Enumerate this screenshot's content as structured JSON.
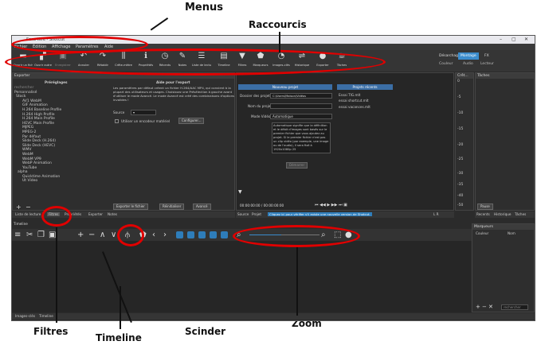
{
  "window": {
    "title": "Sans titre - Shotcut"
  },
  "menu": [
    "Fichier",
    "Édition",
    "Affichage",
    "Paramètres",
    "Aide"
  ],
  "toolbar": [
    {
      "label": "Ouvrir un fichier",
      "icon": "folder-icon"
    },
    {
      "label": "Ouvrir autre",
      "icon": "open-other-icon"
    },
    {
      "label": "Enregistrer",
      "icon": "save-icon"
    },
    {
      "label": "Annuler",
      "icon": "undo-icon"
    },
    {
      "label": "Rétablir",
      "icon": "redo-icon"
    },
    {
      "label": "Crête-mètre",
      "icon": "meter-icon"
    },
    {
      "label": "Propriétés",
      "icon": "info-icon"
    },
    {
      "label": "Récents",
      "icon": "clock-icon"
    },
    {
      "label": "Notes",
      "icon": "notes-icon"
    },
    {
      "label": "Liste de lecture",
      "icon": "playlist-icon"
    },
    {
      "label": "Timeline",
      "icon": "timeline-icon"
    },
    {
      "label": "Filtres",
      "icon": "filter-icon"
    },
    {
      "label": "Marqueurs",
      "icon": "marker-icon"
    },
    {
      "label": "Images-clés",
      "icon": "keyframes-icon"
    },
    {
      "label": "Historique",
      "icon": "history-icon"
    },
    {
      "label": "Exporter",
      "icon": "export-icon"
    },
    {
      "label": "Tâches",
      "icon": "jobs-icon"
    }
  ],
  "workspaces": {
    "tabs": [
      "Désarchage",
      "Montage",
      "FX"
    ],
    "active": "Montage",
    "sub": [
      "Couleur",
      "Audio",
      "Lecteur"
    ]
  },
  "export_panel": {
    "title": "Exporter",
    "presets_header": "Préréglages",
    "search_placeholder": "rechercher",
    "presets": [
      "Personnalisé",
      "Stock",
      "AV1 WebM",
      "GIF Animation",
      "H.264 Baseline Profile",
      "H.264 High Profile",
      "H.264 Main Profile",
      "HEVC Main Profile",
      "MJPEG",
      "MPEG-2",
      "Par défaut",
      "Slide Deck (H.264)",
      "Slide Deck (HEVC)",
      "WMV",
      "WebM",
      "WebM VP9",
      "WebP Animation",
      "YouTube",
      "alpha",
      "Quicktime Animation",
      "Ut Video",
      "Ut Video (4:4:4) alpha"
    ],
    "help_title": "Aide pour l'export",
    "help_text": "Les paramètres par défaut créent un fichier H.264/AAC MP4, qui convient à la plupart des utilisateurs et usages. Choisissez une Présélection à gauche avant d'utiliser le mode Avancé. Le mode Avancé est créé des combinaisons d'options invalides !",
    "source_label": "Source",
    "hw_label": "Utiliser un encodeur matériel",
    "configure": "Configurer...",
    "export_btn": "Exporter le fichier",
    "reset_btn": "Réinitialiser",
    "advanced_btn": "Avancé"
  },
  "new_project": {
    "title": "Nouveau projet",
    "folder_label": "Dossier des projets",
    "folder_value": "C:\\Users\\Maison\\Vidéos",
    "name_label": "Nom du projet",
    "mode_label": "Mode Vidéo",
    "mode_value": "Automatique",
    "desc": "Automatique signifie que la définition et le débit d'images sont basés sur le premier fichier que vous ajoutez au projet. Si le premier fichier n'est pas un clip vidéo (par exemple, une image ou de l'audio), il sera fixé à 1920x1080p 25",
    "start": "Démarrer"
  },
  "recent": {
    "title": "Projets récents",
    "items": [
      "Essai TIG.mlt",
      "essai shortcut.mlt",
      "essai vacances.mlt"
    ]
  },
  "player": {
    "timecode": "00:00:00:00",
    "duration": "00:00:00:00",
    "source_tab": "Source",
    "project_tab": "Projet",
    "message": "Cliquez ici pour vérifier s'il existe une nouvelle version de Shotcut."
  },
  "meter": {
    "title": "Crêt...",
    "labels": [
      "0",
      "-5",
      "-10",
      "-15",
      "-20",
      "-25",
      "-30",
      "-35",
      "-40",
      "-50"
    ],
    "lr": "L R"
  },
  "lower_tabs": [
    "Liste de lecture",
    "Filtres",
    "Propriétés",
    "Exporter",
    "Notes"
  ],
  "right_panel": {
    "title": "Tâches",
    "buttons": [
      "Pause",
      "Recents",
      "Historique",
      "Tâches"
    ],
    "markers_title": "Marqueurs",
    "col_color": "Couleur",
    "col_name": "Nom",
    "search_placeholder": "rechercher"
  },
  "timeline": {
    "title": "Timeline",
    "bottom_tabs": [
      "Images-clés",
      "Timeline"
    ]
  },
  "callouts": {
    "menus": "Menus",
    "raccourcis": "Raccourcis",
    "filtres": "Filtres",
    "timeline": "Timeline",
    "scinder": "Scinder",
    "zoom": "Zoom"
  }
}
